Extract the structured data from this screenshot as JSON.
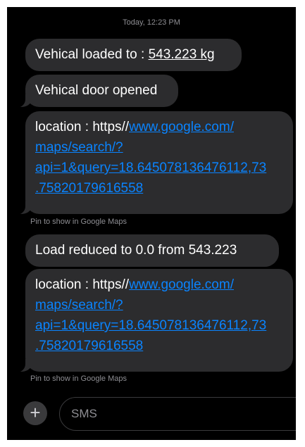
{
  "timestamp": "Today, 12:23 PM",
  "messages": {
    "m1": {
      "prefix": "Vehical loaded to : ",
      "weight": "543.223 kg"
    },
    "m2": {
      "text": "Vehical door opened"
    },
    "m3": {
      "prefix": "location : https//",
      "link_line1": "www.google.com/",
      "link_line2": "maps/search/?",
      "link_line3": "api=1&query=18.645078136476112,73",
      "link_line4": ".75820179616558"
    },
    "m4": {
      "text": "Load reduced to 0.0 from 543.223"
    },
    "m5": {
      "prefix": "location : https//",
      "link_line1": "www.google.com/",
      "link_line2": "maps/search/?",
      "link_line3": "api=1&query=18.645078136476112,73",
      "link_line4": ".75820179616558"
    }
  },
  "caption": "Pin to show in Google Maps",
  "composer": {
    "plus_icon": "plus-icon",
    "plus_glyph": "+",
    "placeholder": "SMS"
  }
}
